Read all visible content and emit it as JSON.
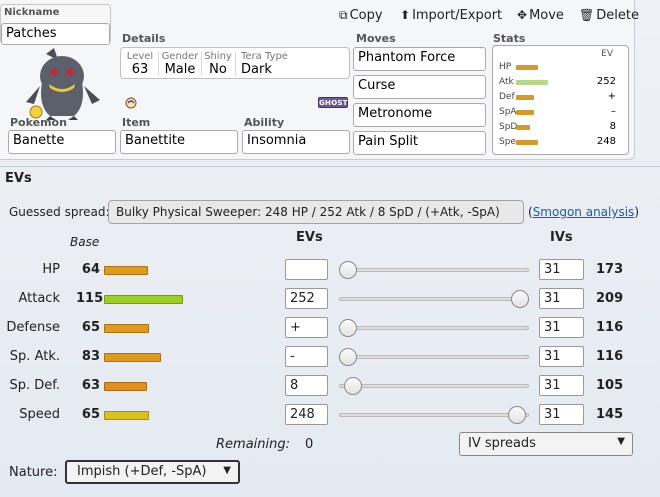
{
  "nickname": {
    "label": "Nickname",
    "value": "Patches"
  },
  "actions": {
    "copy": "Copy",
    "import_export": "Import/Export",
    "move": "Move",
    "delete": "Delete"
  },
  "details": {
    "label": "Details",
    "level_label": "Level",
    "level": "63",
    "gender_label": "Gender",
    "gender": "Male",
    "shiny_label": "Shiny",
    "shiny": "No",
    "tera_label": "Tera Type",
    "tera": "Dark"
  },
  "type_badge": "GHOST",
  "pokemon": {
    "label": "Pokemon",
    "value": "Banette"
  },
  "item": {
    "label": "Item",
    "value": "Banettite"
  },
  "ability": {
    "label": "Ability",
    "value": "Insomnia"
  },
  "moves": {
    "label": "Moves",
    "list": [
      "Phantom Force",
      "Curse",
      "Metronome",
      "Pain Split"
    ]
  },
  "stats_panel": {
    "label": "Stats",
    "ev_header": "EV",
    "rows": [
      {
        "name": "HP",
        "ev": "",
        "color": "#d39a2a"
      },
      {
        "name": "Atk",
        "ev": "252",
        "color": "#b7d78b"
      },
      {
        "name": "Def",
        "ev": "+",
        "color": "#d39a2a"
      },
      {
        "name": "SpA",
        "ev": "–",
        "color": "#d39a2a"
      },
      {
        "name": "SpD",
        "ev": "8",
        "color": "#d39a2a"
      },
      {
        "name": "Spe",
        "ev": "248",
        "color": "#d39a2a"
      }
    ]
  },
  "evs_section": {
    "title": "EVs",
    "guessed_label": "Guessed spread:",
    "guessed_value": "Bulky Physical Sweeper: 248 HP / 252 Atk / 8 SpD / (+Atk, -SpA)",
    "smogon_open": "(",
    "smogon_link": "Smogon analysis",
    "smogon_close": ")",
    "col_base": "Base",
    "col_evs": "EVs",
    "col_ivs": "IVs",
    "stats": [
      {
        "name": "HP",
        "base": "64",
        "ev": "",
        "iv": "31",
        "total": "173",
        "color": "#e09a1c",
        "slider": 0
      },
      {
        "name": "Attack",
        "base": "115",
        "ev": "252",
        "iv": "31",
        "total": "209",
        "color": "#9dd01f",
        "slider": 252
      },
      {
        "name": "Defense",
        "base": "65",
        "ev": "+",
        "iv": "31",
        "total": "116",
        "color": "#e09a1c",
        "slider": 0
      },
      {
        "name": "Sp. Atk.",
        "base": "83",
        "ev": "-",
        "iv": "31",
        "total": "116",
        "color": "#e09a1c",
        "slider": 0
      },
      {
        "name": "Sp. Def.",
        "base": "63",
        "ev": "8",
        "iv": "31",
        "total": "105",
        "color": "#e0901c",
        "slider": 8
      },
      {
        "name": "Speed",
        "base": "65",
        "ev": "248",
        "iv": "31",
        "total": "145",
        "color": "#d9c21e",
        "slider": 248
      }
    ],
    "remaining_label": "Remaining:",
    "remaining_value": "0",
    "iv_spreads": "IV spreads",
    "nature_label": "Nature:",
    "nature_value": "Impish (+Def, -SpA)"
  }
}
